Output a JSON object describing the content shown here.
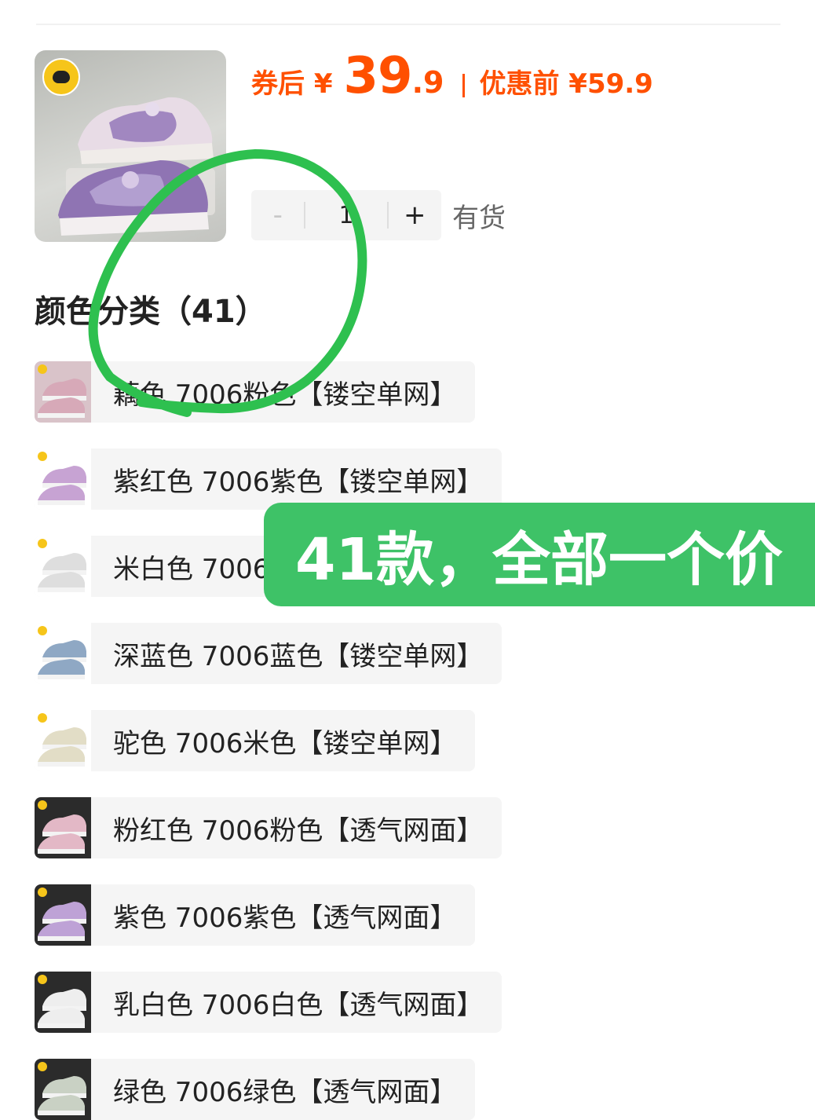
{
  "product": {
    "coupon_prefix": "券后 ¥",
    "price_integer": "39",
    "price_decimal": ".9",
    "before_label": "优惠前 ¥59.9",
    "quantity": "1",
    "stock_label": "有货",
    "brand_icon": "duck-logo-icon"
  },
  "stepper": {
    "minus": "-",
    "plus": "+"
  },
  "section": {
    "title": "颜色分类（41）"
  },
  "options": [
    {
      "label": "藕色 7006粉色【镂空单网】",
      "thumb_bg": "#d9c3c9",
      "shoe_color": "#d7a9b8",
      "logo_bg": "#ffffff"
    },
    {
      "label": "紫红色 7006紫色【镂空单网】",
      "thumb_bg": "#ffffff",
      "shoe_color": "#c7a3d3",
      "logo_bg": "#ffffff"
    },
    {
      "label": "米白色 7006白色【镂空单网】",
      "thumb_bg": "#ffffff",
      "shoe_color": "#dedede",
      "logo_bg": "#ffffff"
    },
    {
      "label": "深蓝色 7006蓝色【镂空单网】",
      "thumb_bg": "#ffffff",
      "shoe_color": "#8fa8c4",
      "logo_bg": "#ffffff"
    },
    {
      "label": "驼色 7006米色【镂空单网】",
      "thumb_bg": "#ffffff",
      "shoe_color": "#e2ddc6",
      "logo_bg": "#ffffff"
    },
    {
      "label": "粉红色 7006粉色【透气网面】",
      "thumb_bg": "#2b2b2b",
      "shoe_color": "#e3b8c6",
      "logo_bg": "#2b2b2b"
    },
    {
      "label": "紫色 7006紫色【透气网面】",
      "thumb_bg": "#2b2b2b",
      "shoe_color": "#bea2d6",
      "logo_bg": "#2b2b2b"
    },
    {
      "label": "乳白色 7006白色【透气网面】",
      "thumb_bg": "#2b2b2b",
      "shoe_color": "#eeeeee",
      "logo_bg": "#2b2b2b"
    },
    {
      "label": "绿色 7006绿色【透气网面】",
      "thumb_bg": "#2b2b2b",
      "shoe_color": "#c9d1c4",
      "logo_bg": "#2b2b2b"
    }
  ],
  "annotation": {
    "callout_text": "41款，全部一个价",
    "circle_color": "#2ec04f",
    "callout_color": "#3ec267"
  },
  "colors": {
    "price": "#ff5000",
    "option_bg": "#f5f5f5"
  }
}
